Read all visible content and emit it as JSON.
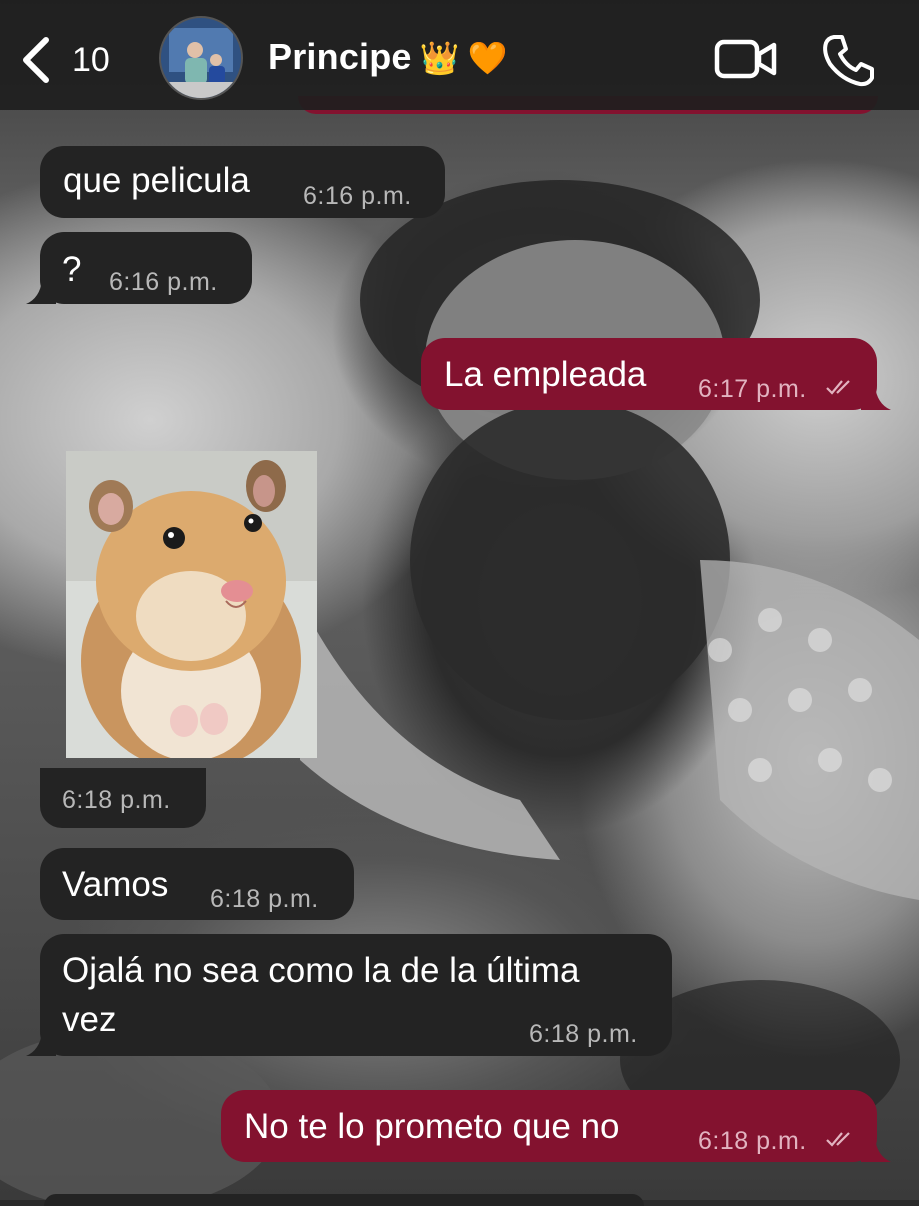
{
  "header": {
    "back_count": "10",
    "contact_name": "Principe",
    "contact_emojis": [
      "👑",
      "🧡"
    ],
    "icons": [
      "chevron-left-icon",
      "avatar",
      "video-call-icon",
      "phone-call-icon"
    ]
  },
  "messages": [
    {
      "direction": "incoming",
      "text": "que pelicula",
      "time": "6:16 p.m."
    },
    {
      "direction": "incoming",
      "text": "?",
      "time": "6:16 p.m."
    },
    {
      "direction": "outgoing",
      "text": "La empleada",
      "time": "6:17 p.m.",
      "status": "read"
    },
    {
      "direction": "incoming",
      "type": "image",
      "description": "hamster photo",
      "time": "6:18 p.m."
    },
    {
      "direction": "incoming",
      "text": "Vamos",
      "time": "6:18 p.m."
    },
    {
      "direction": "incoming",
      "text_line1": "Ojalá no sea como la de la última",
      "text_line2": "vez",
      "time": "6:18 p.m."
    },
    {
      "direction": "outgoing",
      "text": "No te lo prometo que no",
      "time": "6:18 p.m.",
      "status": "read"
    }
  ],
  "colors": {
    "incoming_bubble": "#232323",
    "outgoing_bubble": "#83122f",
    "header_bg": "#1e1e1e"
  }
}
